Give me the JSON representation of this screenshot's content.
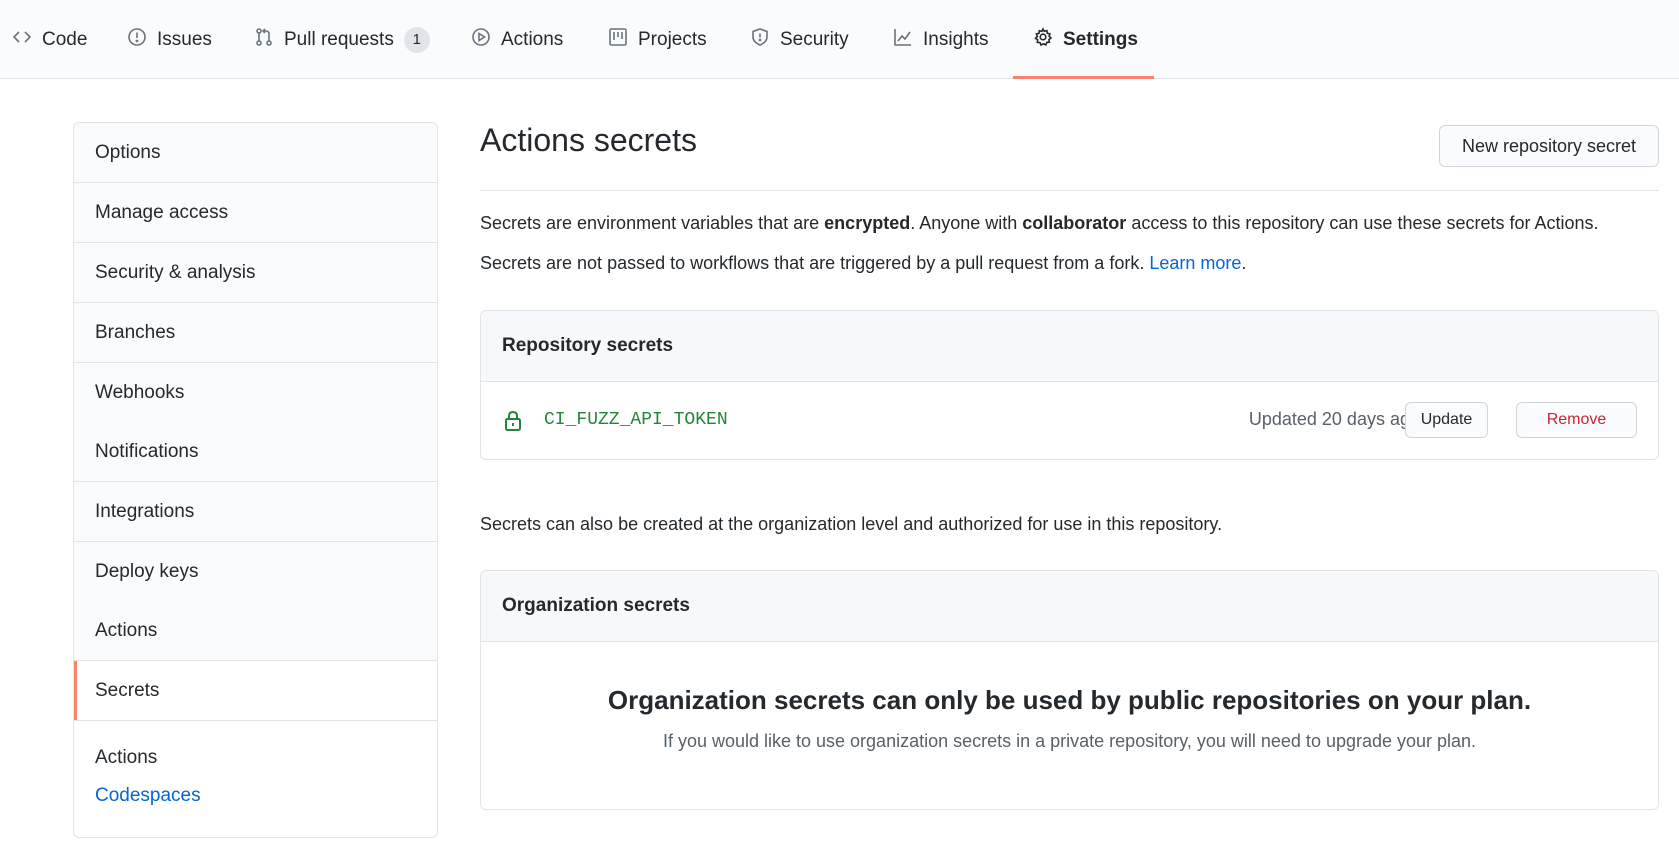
{
  "nav": {
    "tabs": [
      {
        "label": "Code",
        "icon": "code-icon"
      },
      {
        "label": "Issues",
        "icon": "issue-icon"
      },
      {
        "label": "Pull requests",
        "icon": "pull-request-icon",
        "count": "1"
      },
      {
        "label": "Actions",
        "icon": "play-icon"
      },
      {
        "label": "Projects",
        "icon": "project-icon"
      },
      {
        "label": "Security",
        "icon": "shield-icon"
      },
      {
        "label": "Insights",
        "icon": "graph-icon"
      },
      {
        "label": "Settings",
        "icon": "gear-icon",
        "active": true
      }
    ],
    "accent_color": "#f9826c"
  },
  "sidebar": {
    "items": [
      {
        "label": "Options"
      },
      {
        "label": "Manage access"
      },
      {
        "label": "Security & analysis"
      },
      {
        "label": "Branches"
      },
      {
        "label": "Webhooks"
      },
      {
        "label": "Notifications"
      },
      {
        "label": "Integrations"
      },
      {
        "label": "Deploy keys"
      },
      {
        "label": "Actions"
      },
      {
        "label": "Secrets",
        "selected": true
      }
    ],
    "sub_label": "Actions",
    "sub_link": "Codespaces"
  },
  "main": {
    "title": "Actions secrets",
    "new_button": "New repository secret",
    "intro": {
      "p1_a": "Secrets are environment variables that are ",
      "p1_b": "encrypted",
      "p1_c": ". Anyone with ",
      "p1_d": "collaborator",
      "p1_e": " access to this repository can use these secrets for Actions.",
      "p2_a": "Secrets are not passed to workflows that are triggered by a pull request from a fork. ",
      "p2_link": "Learn more",
      "p2_end": "."
    },
    "repo_secrets": {
      "heading": "Repository secrets",
      "rows": [
        {
          "name": "CI_FUZZ_API_TOKEN",
          "updated": "Updated 20 days ago",
          "update_label": "Update",
          "remove_label": "Remove"
        }
      ]
    },
    "org_note": "Secrets can also be created at the organization level and authorized for use in this repository.",
    "org_secrets": {
      "heading": "Organization secrets",
      "blank_title": "Organization secrets can only be used by public repositories on your plan.",
      "blank_sub": "If you would like to use organization secrets in a private repository, you will need to upgrade your plan."
    }
  }
}
